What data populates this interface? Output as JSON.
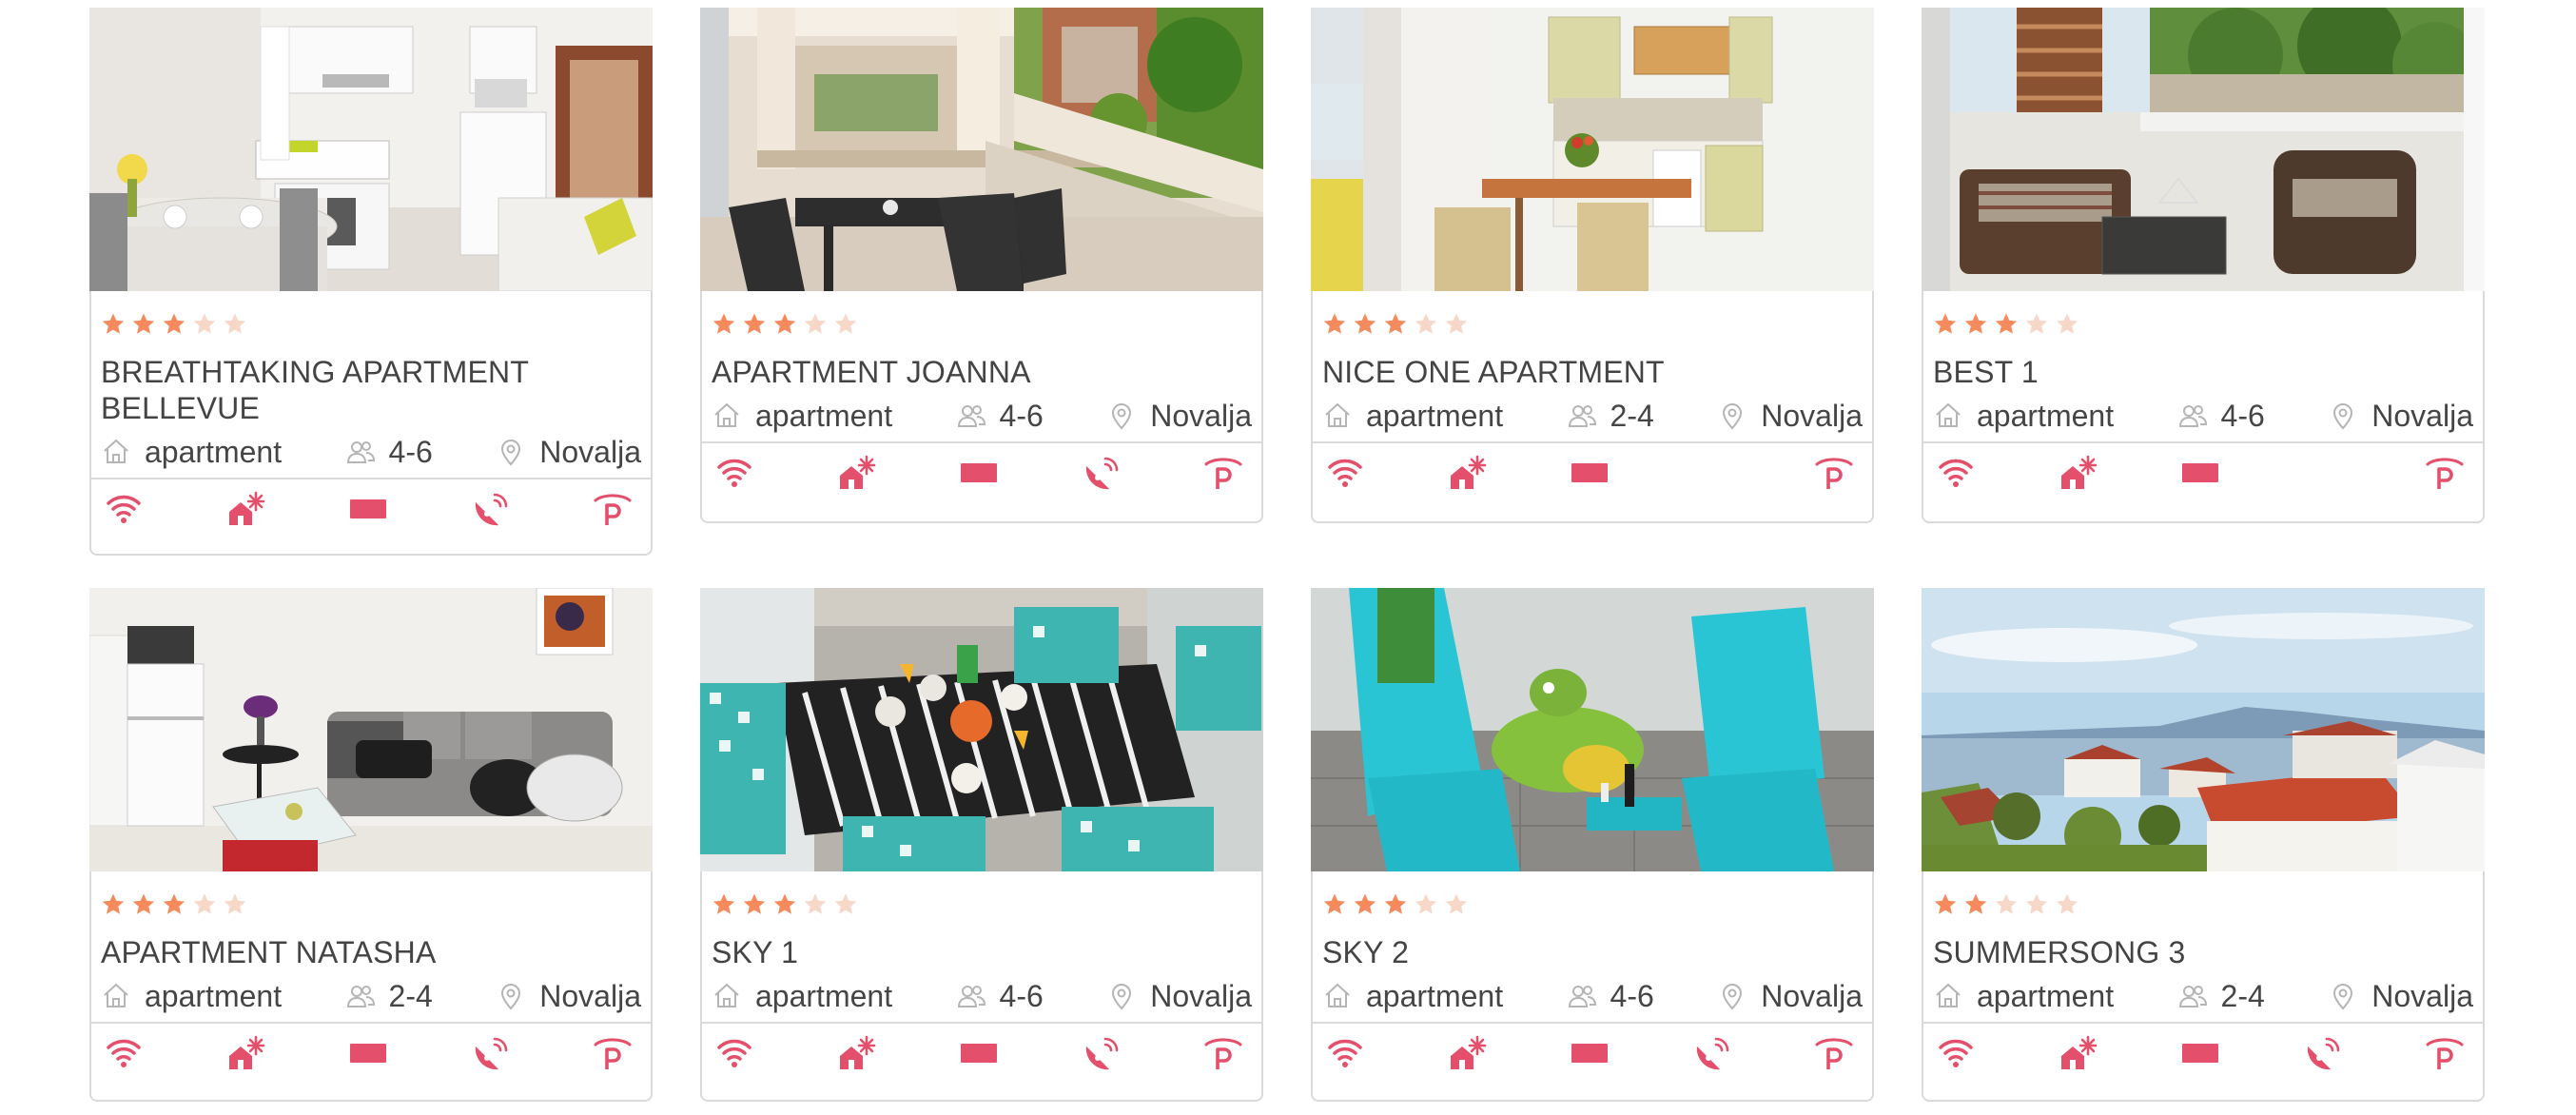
{
  "colors": {
    "accent": "#e4506b",
    "star_on": "#f58a5c",
    "star_off": "#f7d7c8",
    "border": "#dadada"
  },
  "listings": [
    {
      "title": "BREATHTAKING APARTMENT BELLEVUE",
      "stars": 3,
      "stars_max": 5,
      "type": "apartment",
      "guests": "4-6",
      "location": "Novalja",
      "photo": "kitchen-living-room",
      "amenities": [
        "wifi-icon",
        "air-conditioning-icon",
        "tv-icon",
        "satellite-icon",
        "parking-icon"
      ]
    },
    {
      "title": "APARTMENT JOANNA",
      "stars": 3,
      "stars_max": 5,
      "type": "apartment",
      "guests": "4-6",
      "location": "Novalja",
      "photo": "covered-terrace",
      "amenities": [
        "wifi-icon",
        "air-conditioning-icon",
        "tv-icon",
        "satellite-icon",
        "parking-icon"
      ]
    },
    {
      "title": "NICE ONE APARTMENT",
      "stars": 3,
      "stars_max": 5,
      "type": "apartment",
      "guests": "2-4",
      "location": "Novalja",
      "photo": "kitchen-dining",
      "amenities": [
        "wifi-icon",
        "air-conditioning-icon",
        "tv-icon",
        "parking-icon"
      ]
    },
    {
      "title": "BEST 1",
      "stars": 3,
      "stars_max": 5,
      "type": "apartment",
      "guests": "4-6",
      "location": "Novalja",
      "photo": "balcony-wicker-furniture",
      "amenities": [
        "wifi-icon",
        "air-conditioning-icon",
        "tv-icon",
        "parking-icon"
      ]
    },
    {
      "title": "APARTMENT NATASHA",
      "stars": 3,
      "stars_max": 5,
      "type": "apartment",
      "guests": "2-4",
      "location": "Novalja",
      "photo": "living-room-sofa",
      "amenities": [
        "wifi-icon",
        "air-conditioning-icon",
        "tv-icon",
        "satellite-icon",
        "parking-icon"
      ]
    },
    {
      "title": "SKY 1",
      "stars": 3,
      "stars_max": 5,
      "type": "apartment",
      "guests": "4-6",
      "location": "Novalja",
      "photo": "dining-table-terrace",
      "amenities": [
        "wifi-icon",
        "air-conditioning-icon",
        "tv-icon",
        "satellite-icon",
        "parking-icon"
      ]
    },
    {
      "title": "SKY 2",
      "stars": 3,
      "stars_max": 5,
      "type": "apartment",
      "guests": "4-6",
      "location": "Novalja",
      "photo": "sun-loungers-terrace",
      "amenities": [
        "wifi-icon",
        "air-conditioning-icon",
        "tv-icon",
        "satellite-icon",
        "parking-icon"
      ]
    },
    {
      "title": "SUMMERSONG 3",
      "stars": 2,
      "stars_max": 5,
      "type": "apartment",
      "guests": "2-4",
      "location": "Novalja",
      "photo": "sea-view",
      "amenities": [
        "wifi-icon",
        "air-conditioning-icon",
        "tv-icon",
        "satellite-icon",
        "parking-icon"
      ]
    }
  ]
}
